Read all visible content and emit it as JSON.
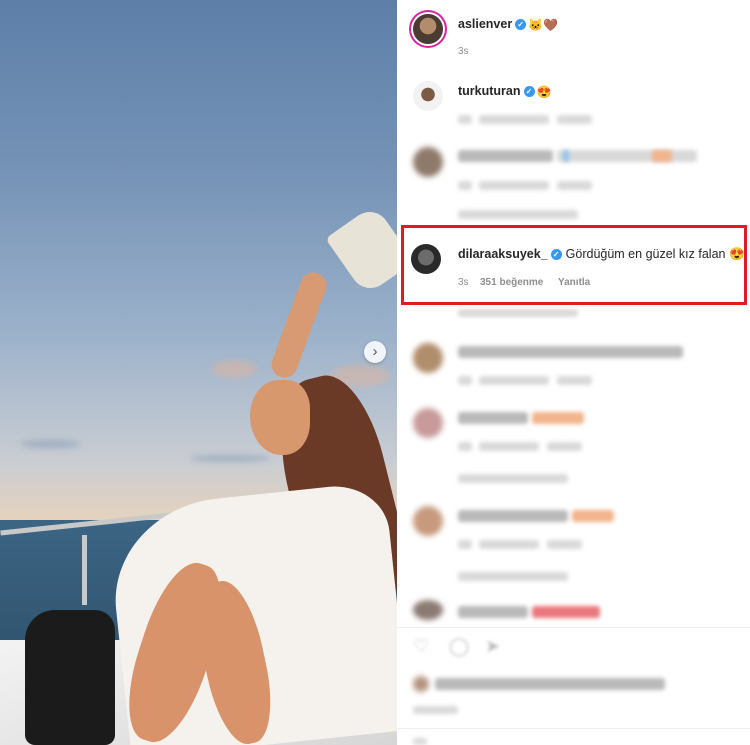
{
  "post": {
    "author": "aslienver",
    "author_emojis": "🐱🤎",
    "time": "3s"
  },
  "comments": [
    {
      "username": "turkuturan",
      "emoji": "😍"
    },
    {
      "username": "dilaraaksuyek_",
      "text": "Gördüğüm en güzel kız falan 😍",
      "time": "3s",
      "likes": "351 beğenme",
      "reply": "Yanıtla"
    }
  ],
  "icons": {
    "next": "›",
    "verified": "✓"
  },
  "colors": {
    "highlight": "#e21a22",
    "verified": "#3897f0"
  }
}
